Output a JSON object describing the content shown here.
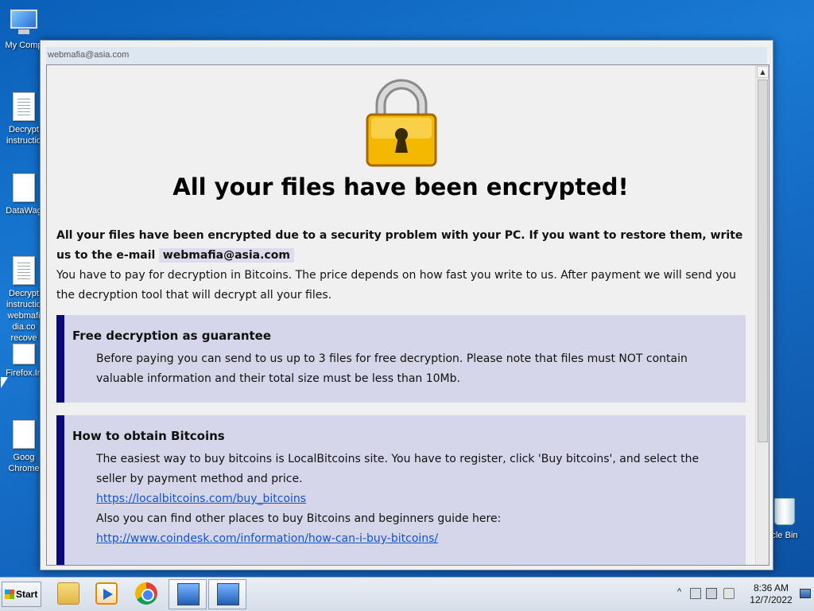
{
  "desktop": {
    "icons": [
      {
        "label": "My Comp",
        "icon": "computer-icon"
      },
      {
        "label": "Decrypt instructio",
        "icon": "text-document-icon"
      },
      {
        "label": "DataWag",
        "icon": "blank-document-icon"
      },
      {
        "label": "Decrypt instructio webmafi dia.co recove",
        "icon": "text-document-icon"
      },
      {
        "label": "Firefox.In",
        "icon": "blank-document-icon"
      },
      {
        "label": "Goog Chrome",
        "icon": "blank-document-icon"
      },
      {
        "label": "cle Bin",
        "icon": "recycle-bin-icon"
      }
    ]
  },
  "window": {
    "title": "webmafia@asia.com"
  },
  "note": {
    "heading": "All your files have been encrypted!",
    "intro_bold": "All your files have been encrypted due to a security problem with your PC. If you want to restore them, write us to the e-mail",
    "email": "webmafia@asia.com",
    "intro_text": "You have to pay for decryption in Bitcoins. The price depends on how fast you write to us. After payment we will send you the decryption tool that will decrypt all your files.",
    "section1": {
      "title": "Free decryption as guarantee",
      "text": "Before paying you can send to us up to 3 files for free decryption. Please note that files must NOT contain valuable information and their total size must be less than 10Mb."
    },
    "section2": {
      "title": "How to obtain Bitcoins",
      "text1": "The easiest way to buy bitcoins is LocalBitcoins site. You have to register, click 'Buy bitcoins', and select the seller by payment method and price.",
      "link1": "https://localbitcoins.com/buy_bitcoins",
      "text2": "Also you can find other places to buy Bitcoins and beginners guide here:",
      "link2": "http://www.coindesk.com/information/how-can-i-buy-bitcoins/"
    }
  },
  "taskbar": {
    "start_label": "Start",
    "apps": [
      "folder-icon",
      "media-player-icon",
      "chrome-icon",
      "network-app-icon",
      "network-app-icon"
    ],
    "tray": {
      "chevron": "^",
      "time": "8:36 AM",
      "date": "12/7/2022"
    }
  },
  "colors": {
    "box_bg": "#d6d6ea",
    "box_border": "#0a0a7a",
    "link": "#1155cc",
    "lock_body": "#f5b800"
  }
}
